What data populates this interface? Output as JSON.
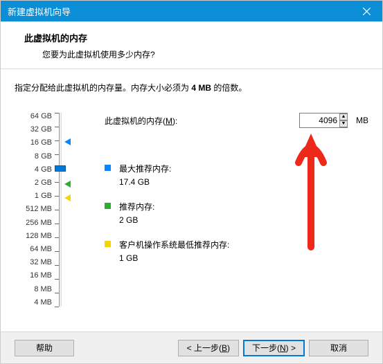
{
  "titlebar": {
    "title": "新建虚拟机向导"
  },
  "header": {
    "title": "此虚拟机的内存",
    "subtitle": "您要为此虚拟机使用多少内存?"
  },
  "desc_prefix": "指定分配给此虚拟机的内存量。内存大小必须为 ",
  "desc_bold": "4 MB",
  "desc_suffix": " 的倍数。",
  "ticks": [
    "64 GB",
    "32 GB",
    "16 GB",
    "8 GB",
    "4 GB",
    "2 GB",
    "1 GB",
    "512 MB",
    "256 MB",
    "128 MB",
    "64 MB",
    "32 MB",
    "16 MB",
    "8 MB",
    "4 MB"
  ],
  "mem": {
    "label_prefix": "此虚拟机的内存(",
    "label_key": "M",
    "label_suffix": "):",
    "value": "4096",
    "unit": "MB"
  },
  "rec_max": {
    "label": "最大推荐内存:",
    "value": "17.4 GB"
  },
  "rec_rec": {
    "label": "推荐内存:",
    "value": "2 GB"
  },
  "rec_min": {
    "label": "客户机操作系统最低推荐内存:",
    "value": "1 GB"
  },
  "buttons": {
    "help": "帮助",
    "back_prefix": "< 上一步(",
    "back_key": "B",
    "back_suffix": ")",
    "next_prefix": "下一步(",
    "next_key": "N",
    "next_suffix": ") >",
    "cancel": "取消"
  }
}
